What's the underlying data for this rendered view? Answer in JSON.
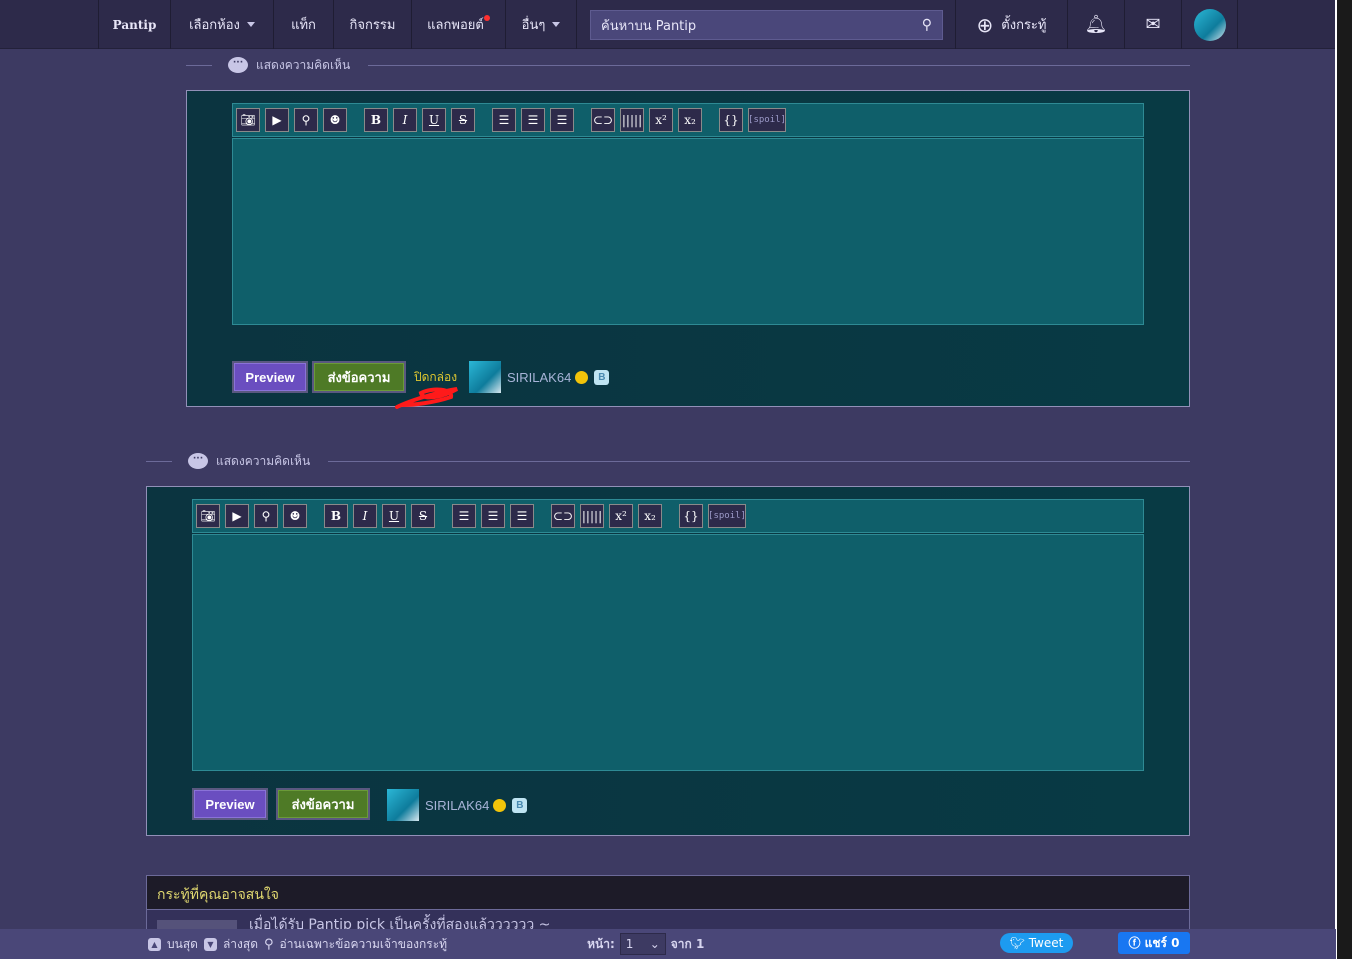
{
  "nav": {
    "logo": "Pantip",
    "items": [
      "เลือกห้อง",
      "แท็ก",
      "กิจกรรม",
      "แลกพอยต์",
      "อื่นๆ"
    ],
    "search_placeholder": "ค้นหาบน Pantip",
    "new_topic": "ตั้งกระทู้"
  },
  "section_title": "แสดงความคิดเห็น",
  "toolbar": [
    "camera",
    "video",
    "location",
    "emoticon",
    "B",
    "I",
    "U",
    "S",
    "align-left",
    "align-center",
    "align-right",
    "link",
    "barcode",
    "x²",
    "x₂",
    "{}",
    "[spoil]"
  ],
  "editor": {
    "preview": "Preview",
    "send": "ส่งข้อความ",
    "close": "ปิดกล่อง",
    "username": "SIRILAK64"
  },
  "interest": {
    "title": "กระทู้ที่คุณอาจสนใจ",
    "items": [
      "เมื่อได้รับ Pantip pick เป็นครั้งที่สองแล้วววววว ~"
    ]
  },
  "bottom": {
    "top": "บนสุด",
    "bottom": "ล่างสุด",
    "owner_only": "อ่านเฉพาะข้อความเจ้าของกระทู้",
    "page_label": "หน้า:",
    "page": "1",
    "of": "จาก 1",
    "tweet": "Tweet",
    "share": "แชร์ 0"
  },
  "colors": {
    "accent_red": "#ff1a1a",
    "send": "#4e7a26",
    "preview": "#6a4ec0"
  }
}
